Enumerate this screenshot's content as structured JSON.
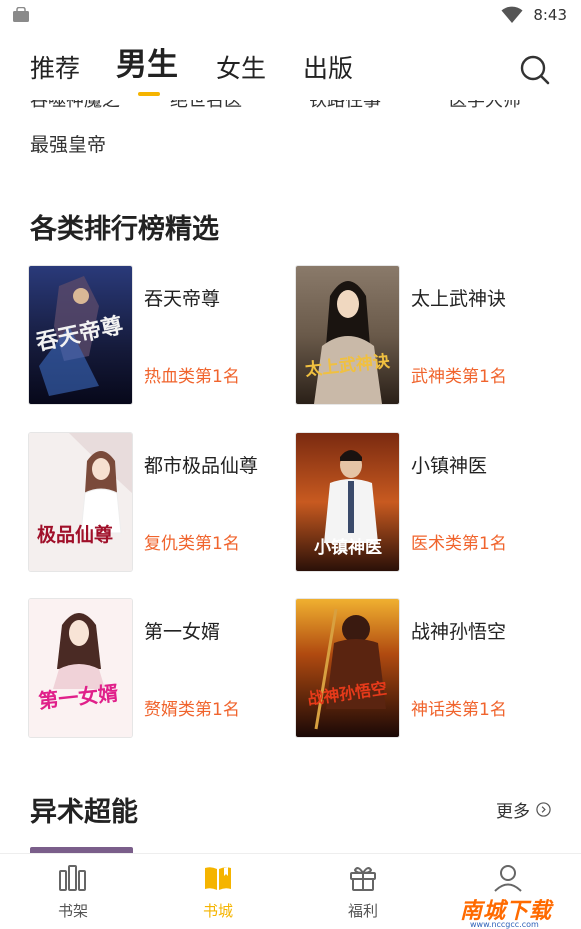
{
  "status": {
    "time": "8:43"
  },
  "tabs": [
    {
      "label": "推荐"
    },
    {
      "label": "男生"
    },
    {
      "label": "女生"
    },
    {
      "label": "出版"
    }
  ],
  "scrolled_titles": [
    "吞噬神魔之",
    "绝世名医",
    "铁路往事",
    "医学大师"
  ],
  "scrolled_extra": "最强皇帝",
  "section_ranking": {
    "title": "各类排行榜精选"
  },
  "books": [
    {
      "title": "吞天帝尊",
      "rank": "热血类第1名",
      "cover_text": "吞天帝尊"
    },
    {
      "title": "太上武神诀",
      "rank": "武神类第1名",
      "cover_text": "太上武神诀"
    },
    {
      "title": "都市极品仙尊",
      "rank": "复仇类第1名",
      "cover_text": "极品仙尊"
    },
    {
      "title": "小镇神医",
      "rank": "医术类第1名",
      "cover_text": "小镇神医"
    },
    {
      "title": "第一女婿",
      "rank": "赘婿类第1名",
      "cover_text": "第一女婿"
    },
    {
      "title": "战神孙悟空",
      "rank": "神话类第1名",
      "cover_text": "战神孙悟空"
    }
  ],
  "section_psychic": {
    "title": "异术超能",
    "more": "更多"
  },
  "bottom_nav": [
    {
      "label": "书架"
    },
    {
      "label": "书城"
    },
    {
      "label": "福利"
    },
    {
      "label": "我的"
    }
  ],
  "watermark": {
    "text": "南城下载",
    "url": "www.nccgcc.com"
  },
  "colors": {
    "accent": "#f5b400",
    "rank": "#f0642d",
    "text": "#222222"
  }
}
